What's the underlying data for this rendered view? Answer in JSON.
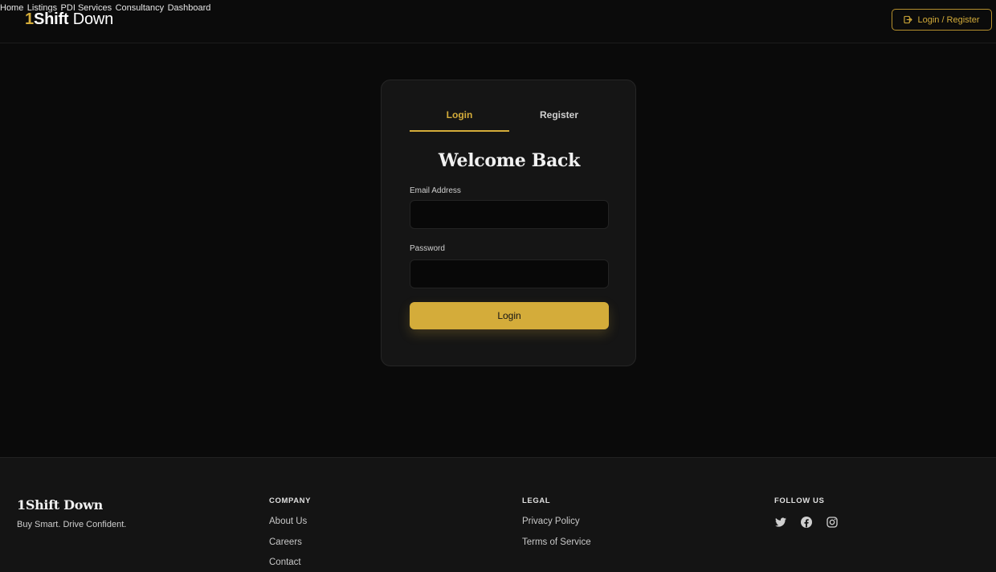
{
  "header": {
    "brand": {
      "part1": "1",
      "part2": "Shift",
      "part3": " Down"
    },
    "nav": [
      "Home",
      "Listings",
      "PDI Services",
      "Consultancy",
      "Dashboard"
    ],
    "login_register_label": "Login / Register",
    "login_register_icon": "login-icon"
  },
  "auth": {
    "tabs": {
      "login": "Login",
      "register": "Register"
    },
    "active_tab": "Login",
    "title": "Welcome Back",
    "email_label": "Email Address",
    "email_value": "",
    "password_label": "Password",
    "password_value": "",
    "submit_label": "Login"
  },
  "footer": {
    "brand": "1Shift Down",
    "tagline": "Buy Smart. Drive Confident.",
    "company": {
      "heading": "COMPANY",
      "links": [
        "About Us",
        "Careers",
        "Contact"
      ]
    },
    "legal": {
      "heading": "LEGAL",
      "links": [
        "Privacy Policy",
        "Terms of Service"
      ]
    },
    "follow": {
      "heading": "FOLLOW US",
      "icons": [
        "twitter-icon",
        "facebook-icon",
        "instagram-icon"
      ]
    }
  },
  "colors": {
    "accent": "#d4ac3a",
    "background": "#0a0a0a",
    "card": "#151515",
    "footer": "#141414"
  }
}
